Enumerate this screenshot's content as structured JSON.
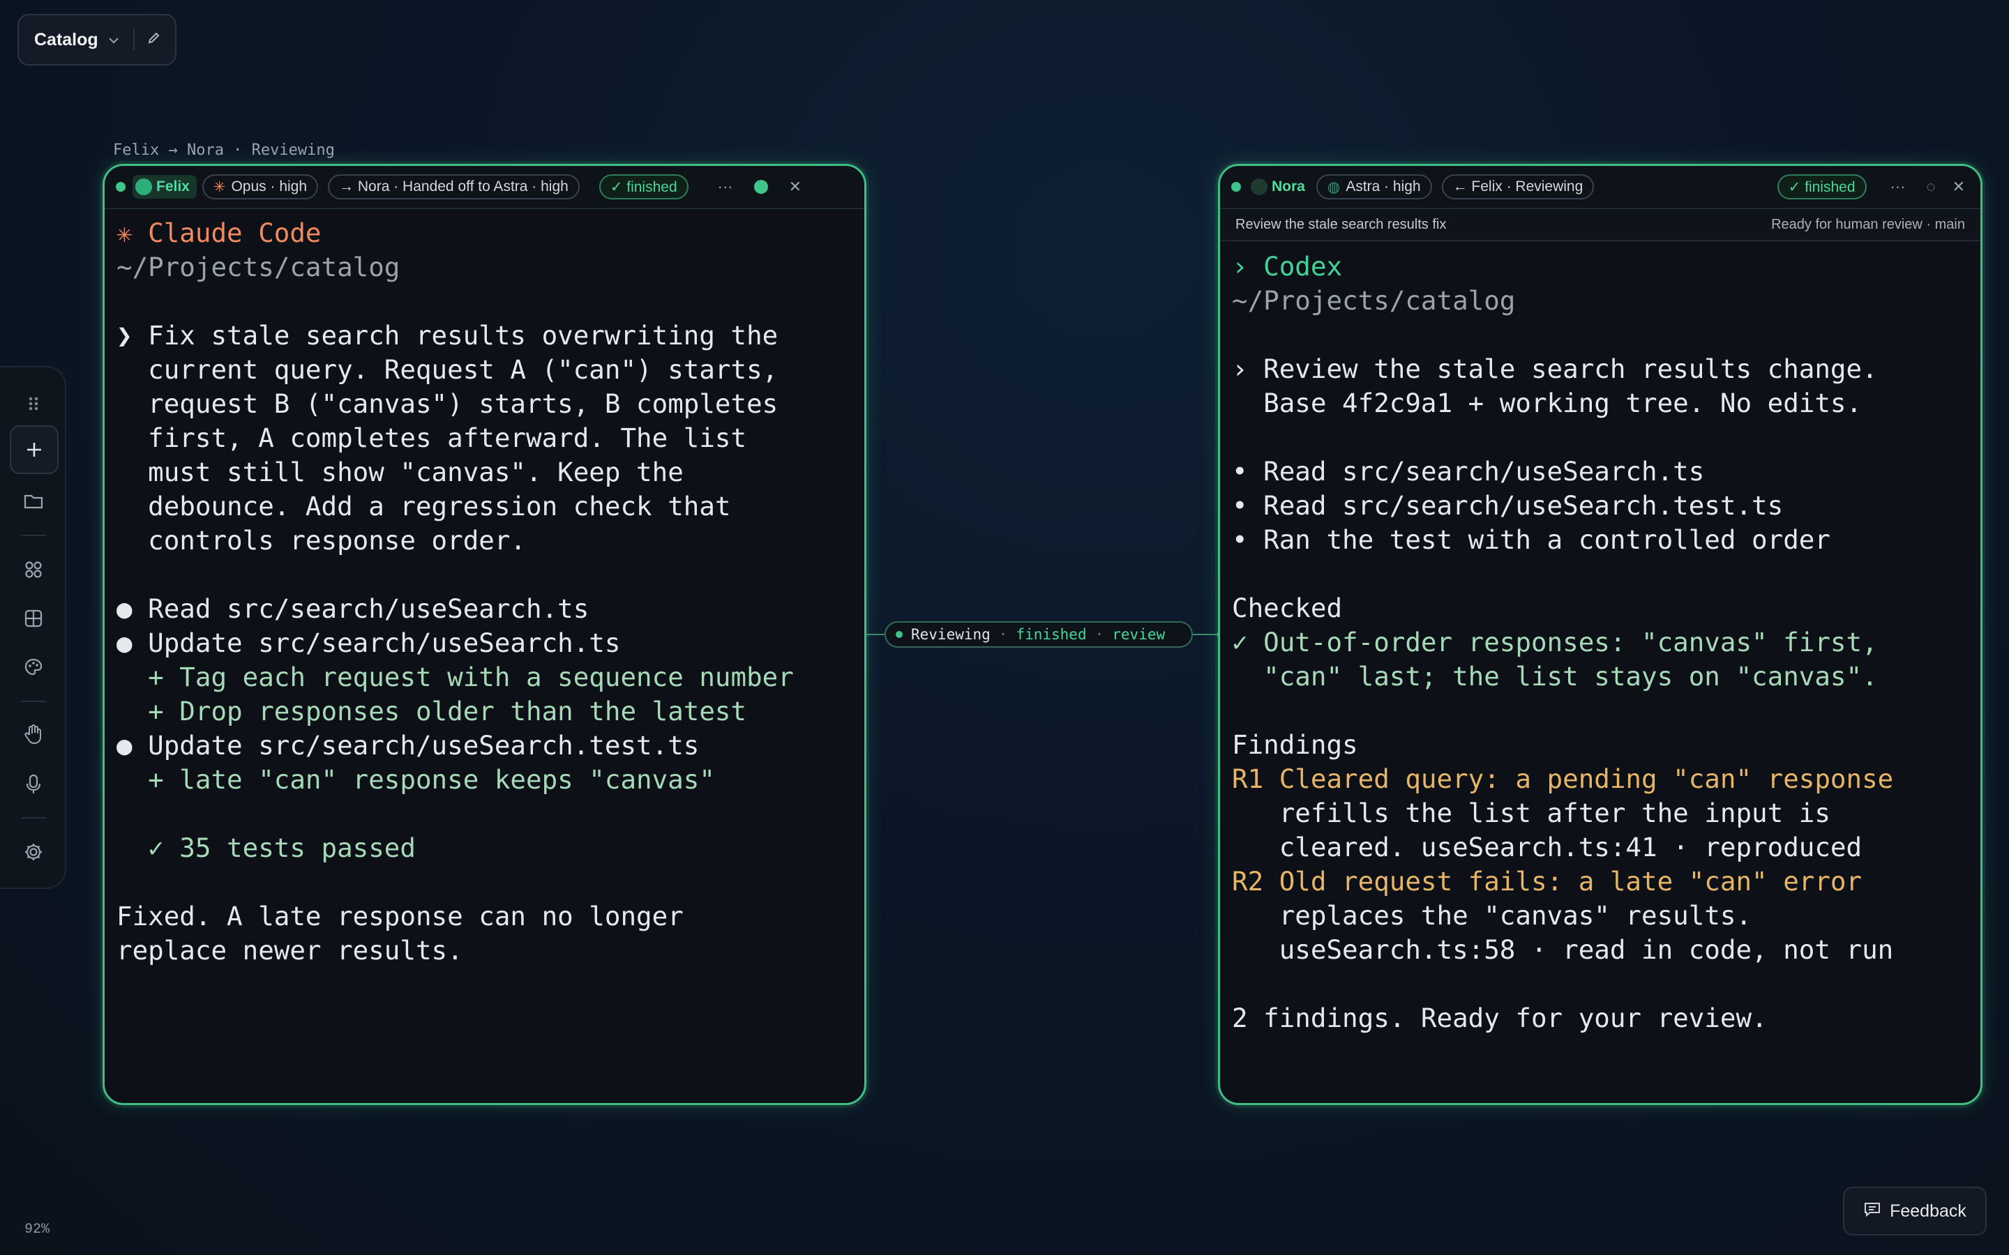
{
  "workspace": {
    "name": "Catalog"
  },
  "zoom": "92%",
  "feedback_label": "Feedback",
  "breadcrumb": "Felix → Nora · Reviewing",
  "left_panel": {
    "agent": "Felix",
    "model_chip": "Opus · high",
    "handoff_chip": "→ Nora · Handed off to Astra · high",
    "status_chip": "✓ finished",
    "app_title": "✳ Claude Code",
    "path": "~/Projects/catalog",
    "lines": [
      "❯ Fix stale search results overwriting the",
      "  current query. Request A (\"can\") starts,",
      "  request B (\"canvas\") starts, B completes",
      "  first, A completes afterward. The list",
      "  must still show \"canvas\". Keep the",
      "  debounce. Add a regression check that",
      "  controls response order.",
      "",
      "● Read src/search/useSearch.ts",
      "● Update src/search/useSearch.ts",
      "  + Tag each request with a sequence number",
      "  + Drop responses older than the latest",
      "● Update src/search/useSearch.test.ts",
      "  + late \"can\" response keeps \"canvas\"",
      "",
      "  ✓ 35 tests passed",
      "",
      "Fixed. A late response can no longer",
      "replace newer results."
    ]
  },
  "connector": {
    "label": "Reviewing",
    "status": "finished",
    "kind": "review"
  },
  "right_panel": {
    "agent": "Nora",
    "model_chip": "Astra · high",
    "handoff_chip": "← Felix · Reviewing",
    "status_chip": "✓ finished",
    "task": "Review the stale search results fix",
    "task_status": "Ready for human review · main",
    "app_title": "› Codex",
    "path": "~/Projects/catalog",
    "lines": [
      "› Review the stale search results change.",
      "  Base 4f2c9a1 + working tree. No edits.",
      "",
      "• Read src/search/useSearch.ts",
      "• Read src/search/useSearch.test.ts",
      "• Ran the test with a controlled order",
      "",
      "Checked",
      "✓ Out-of-order responses: \"canvas\" first,",
      "  \"can\" last; the list stays on \"canvas\".",
      "",
      "Findings",
      "R1 Cleared query: a pending \"can\" response",
      "   refills the list after the input is",
      "   cleared. useSearch.ts:41 · reproduced",
      "R2 Old request fails: a late \"can\" error",
      "   replaces the \"canvas\" results.",
      "   useSearch.ts:58 · read in code, not run",
      "",
      "2 findings. Ready for your review."
    ]
  },
  "colors": {
    "accent": "#3fbf86",
    "claude": "#f08a5d",
    "codex": "#3fd39a",
    "finding": "#e6b566"
  },
  "icons": [
    "grip-icon",
    "plus-icon",
    "folder-icon",
    "apps-icon",
    "grid-icon",
    "palette-icon",
    "hand-icon",
    "mic-icon",
    "gear-icon",
    "chevron-down-icon",
    "edit-icon",
    "chat-icon",
    "more-icon",
    "close-icon",
    "expand-icon"
  ]
}
